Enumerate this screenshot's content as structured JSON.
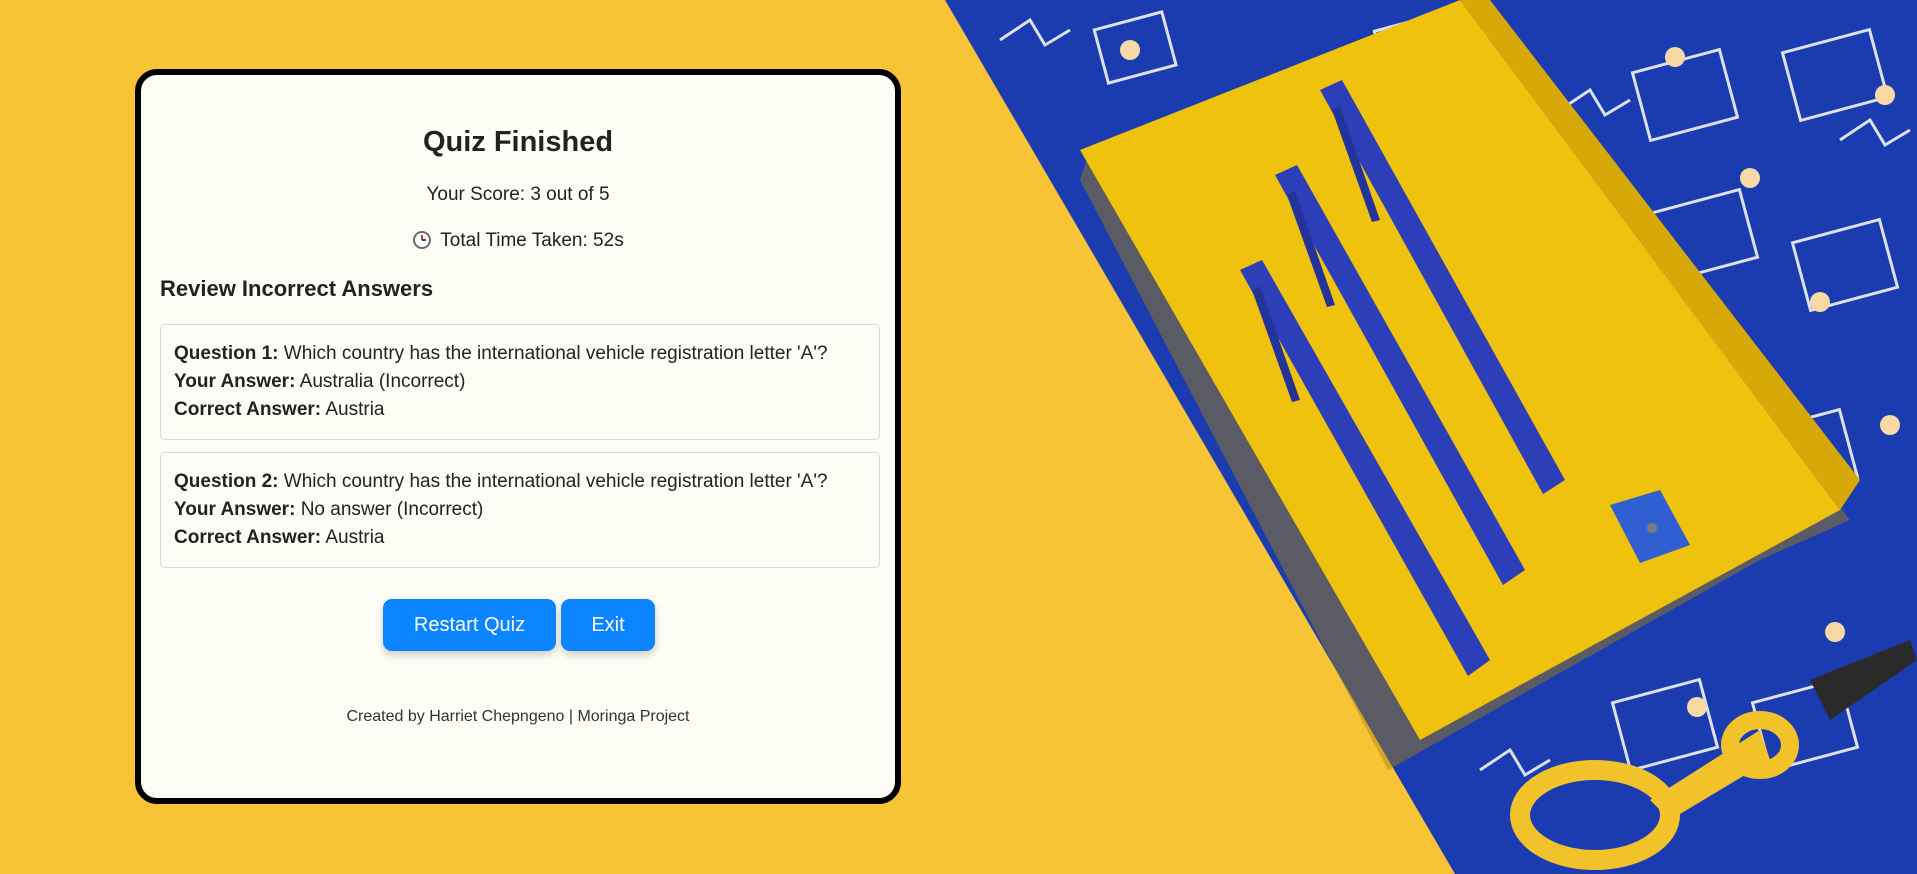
{
  "quiz": {
    "title": "Quiz Finished",
    "score_text": "Your Score: 3 out of 5",
    "time_text": "Total Time Taken: 52s",
    "review_heading": "Review Incorrect Answers",
    "label_question_1": "Question 1:",
    "label_question_2": "Question 2:",
    "label_your_answer": "Your Answer:",
    "label_correct_answer": "Correct Answer:",
    "incorrect": [
      {
        "question": "Which country has the international vehicle registration letter 'A'?",
        "your_answer": "Australia (Incorrect)",
        "correct_answer": "Austria"
      },
      {
        "question": "Which country has the international vehicle registration letter 'A'?",
        "your_answer": "No answer (Incorrect)",
        "correct_answer": "Austria"
      }
    ],
    "restart_label": "Restart Quiz",
    "exit_label": "Exit",
    "footer": "Created by Harriet Chepngeno | Moringa Project",
    "icons": {
      "timer": "clock-icon"
    },
    "colors": {
      "button": "#0a84ff",
      "background": "#f6c435",
      "card": "#fdfcf5"
    }
  }
}
